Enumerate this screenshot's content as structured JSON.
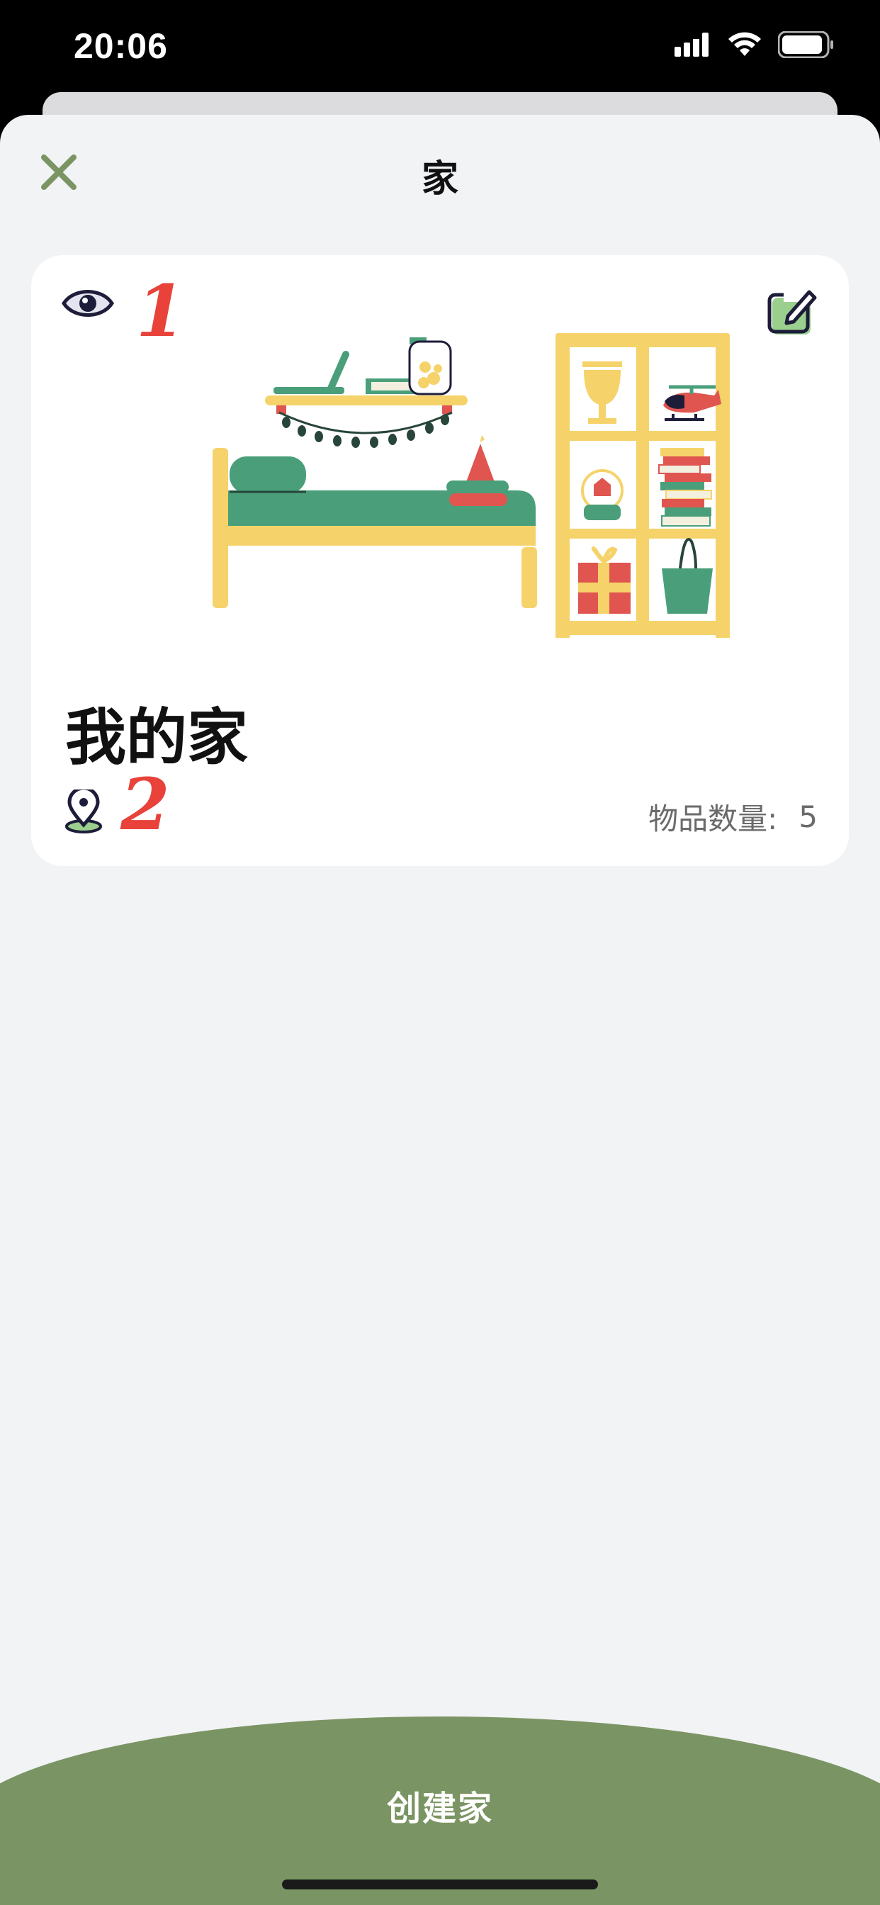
{
  "status_bar": {
    "time": "20:06"
  },
  "header": {
    "title": "家",
    "close_icon": "close-icon"
  },
  "home_card": {
    "visible_badge": "1",
    "name": "我的家",
    "location_badge": "2",
    "item_count_label": "物品数量:",
    "item_count_value": "5",
    "icons": [
      "eye-icon",
      "edit-icon",
      "location-pin-icon"
    ]
  },
  "footer": {
    "create_button_label": "创建家"
  },
  "colors": {
    "accent_green": "#7a9563",
    "close_icon": "#7a9563",
    "badge_red": "#e8423a",
    "sheet_bg": "#f2f3f5"
  }
}
